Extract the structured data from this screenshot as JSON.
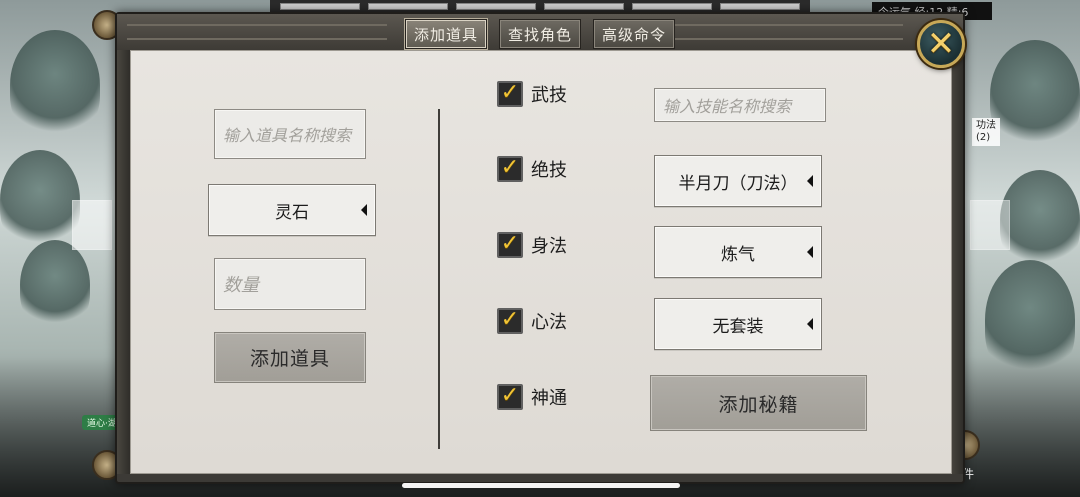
{
  "background": {
    "top_info": "今运气 经:12 精:6",
    "side_tag_line1": "功法",
    "side_tag_line2": "(2)",
    "left_badge": "道心·湖",
    "right_label": "件"
  },
  "tabs": [
    {
      "label": "添加道具",
      "active": true
    },
    {
      "label": "查找角色",
      "active": false
    },
    {
      "label": "高级命令",
      "active": false
    }
  ],
  "close_icon": "✕",
  "left": {
    "item_search_placeholder": "输入道具名称搜索",
    "item_type_selected": "灵石",
    "quantity_placeholder": "数量",
    "add_item_button": "添加道具"
  },
  "middle": {
    "checkboxes": [
      {
        "label": "武技",
        "checked": true
      },
      {
        "label": "绝技",
        "checked": true
      },
      {
        "label": "身法",
        "checked": true
      },
      {
        "label": "心法",
        "checked": true
      },
      {
        "label": "神通",
        "checked": true
      }
    ],
    "check_glyph": "✓"
  },
  "right": {
    "skill_search_placeholder": "输入技能名称搜索",
    "skill_selected": "半月刀（刀法）",
    "realm_selected": "炼气",
    "set_selected": "无套装",
    "add_manual_button": "添加秘籍"
  },
  "colors": {
    "panel": "#e4e1dc",
    "frame": "#3c3a36",
    "accent_gold": "#f1c436",
    "button": "#a8a59e"
  }
}
